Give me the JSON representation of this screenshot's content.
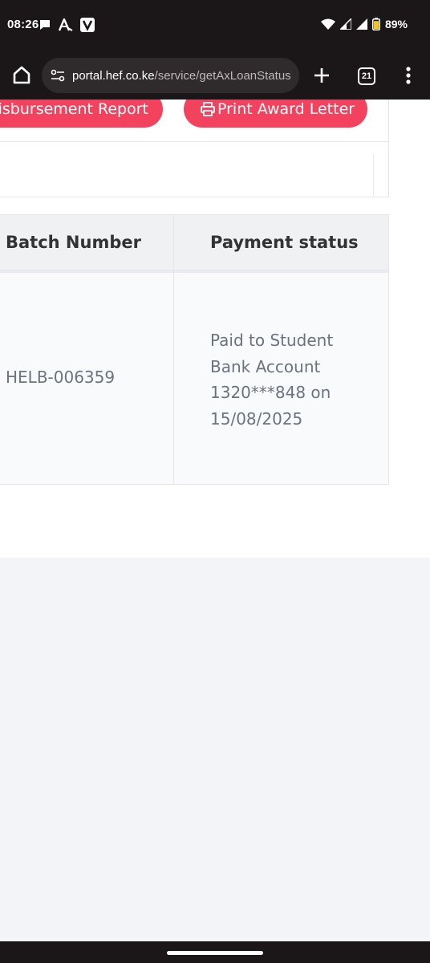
{
  "status_bar": {
    "time": "08:26",
    "battery_percent": "89%",
    "battery_level": 0.89
  },
  "browser": {
    "url_host": "portal.hef.co.ke",
    "url_path": "/service/getAxLoanStatus",
    "tab_count": "21"
  },
  "actions": {
    "disbursement_report_label": "Disbursement Report",
    "print_award_letter_label": "Print Award Letter"
  },
  "table": {
    "headers": [
      "Batch Number",
      "Payment status"
    ],
    "rows": [
      {
        "batch_number": "HELB-006359",
        "payment_status_lines": [
          "Paid to Student",
          "Bank Account",
          "1320***848 on",
          "15/08/2025"
        ]
      }
    ]
  },
  "colors": {
    "accent": "#f2425e",
    "browser_chrome": "#1b1718",
    "page_background": "#f3f4f8"
  }
}
